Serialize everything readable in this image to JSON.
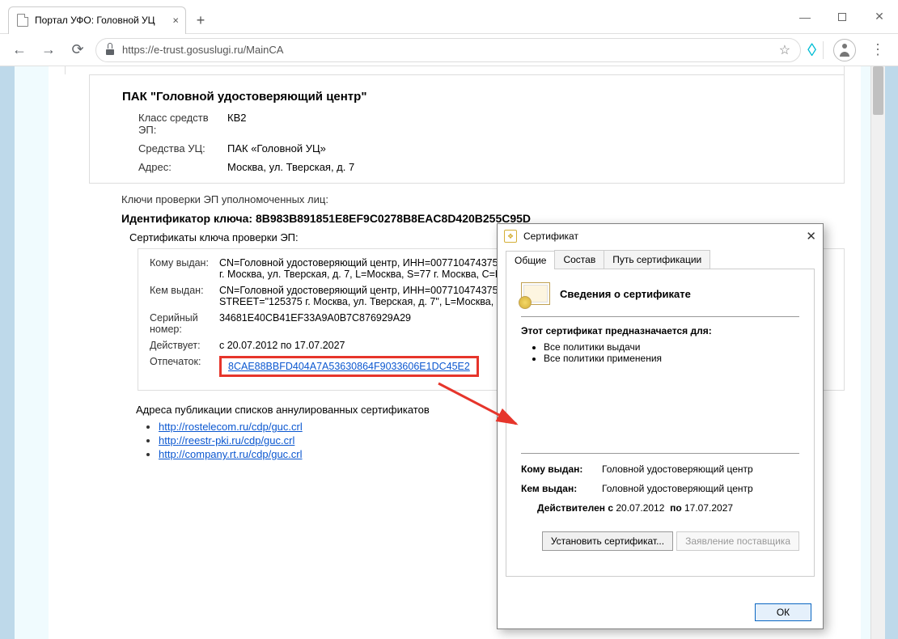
{
  "browser": {
    "tab_title": "Портал УФО: Головной УЦ",
    "url_prefix": "https",
    "url_rest": "://e-trust.gosuslugi.ru/MainCA"
  },
  "page": {
    "title": "ПАК \"Головной удостоверяющий центр\"",
    "class_label": "Класс средств ЭП:",
    "class_value": "КВ2",
    "means_label": "Средства УЦ:",
    "means_value": "ПАК «Головной УЦ»",
    "address_label": "Адрес:",
    "address_value": "Москва, ул. Тверская, д. 7",
    "keys_heading": "Ключи проверки ЭП уполномоченных лиц:",
    "ident_label": "Идентификатор ключа:",
    "ident_value": "8B983B891851E8EF9C0278B8EAC8D420B255C95D",
    "sigcerts_heading": "Сертификаты ключа проверки ЭП:",
    "cert": {
      "to_label": "Кому выдан:",
      "to_value": "CN=Головной удостоверяющий центр, ИНН=007710474375, ОГ\nг. Москва, ул. Тверская, д. 7, L=Москва, S=77 г. Москва, C=RU,",
      "by_label": "Кем выдан:",
      "by_value": "CN=Головной удостоверяющий центр, ИНН=007710474375, ОГ\nSTREET=\"125375 г. Москва, ул. Тверская, д. 7\", L=Москва, S=77",
      "serial_label": "Серийный номер:",
      "serial_value": "34681E40CB41EF33A9A0B7C876929A29",
      "valid_label": "Действует:",
      "valid_value": "с 20.07.2012 по 17.07.2027",
      "fp_label": "Отпечаток:",
      "fp_value": "8CAE88BBFD404A7A53630864F9033606E1DC45E2"
    },
    "crl_heading": "Адреса публикации списков аннулированных сертификатов",
    "crl_links": [
      "http://rostelecom.ru/cdp/guc.crl",
      "http://reestr-pki.ru/cdp/guc.crl",
      "http://company.rt.ru/cdp/guc.crl"
    ]
  },
  "dialog": {
    "title": "Сертификат",
    "tabs": {
      "general": "Общие",
      "content": "Состав",
      "path": "Путь сертификации"
    },
    "info_heading": "Сведения о сертификате",
    "purpose_heading": "Этот сертификат предназначается для:",
    "purposes": [
      "Все политики выдачи",
      "Все политики применения"
    ],
    "issued_to_label": "Кому выдан:",
    "issued_to_value": "Головной удостоверяющий центр",
    "issued_by_label": "Кем выдан:",
    "issued_by_value": "Головной удостоверяющий центр",
    "valid_from_label": "Действителен с",
    "valid_from": "20.07.2012",
    "valid_to_label": "по",
    "valid_to": "17.07.2027",
    "install_button": "Установить сертификат...",
    "issuer_stmt_button": "Заявление поставщика",
    "ok_button": "ОК"
  }
}
